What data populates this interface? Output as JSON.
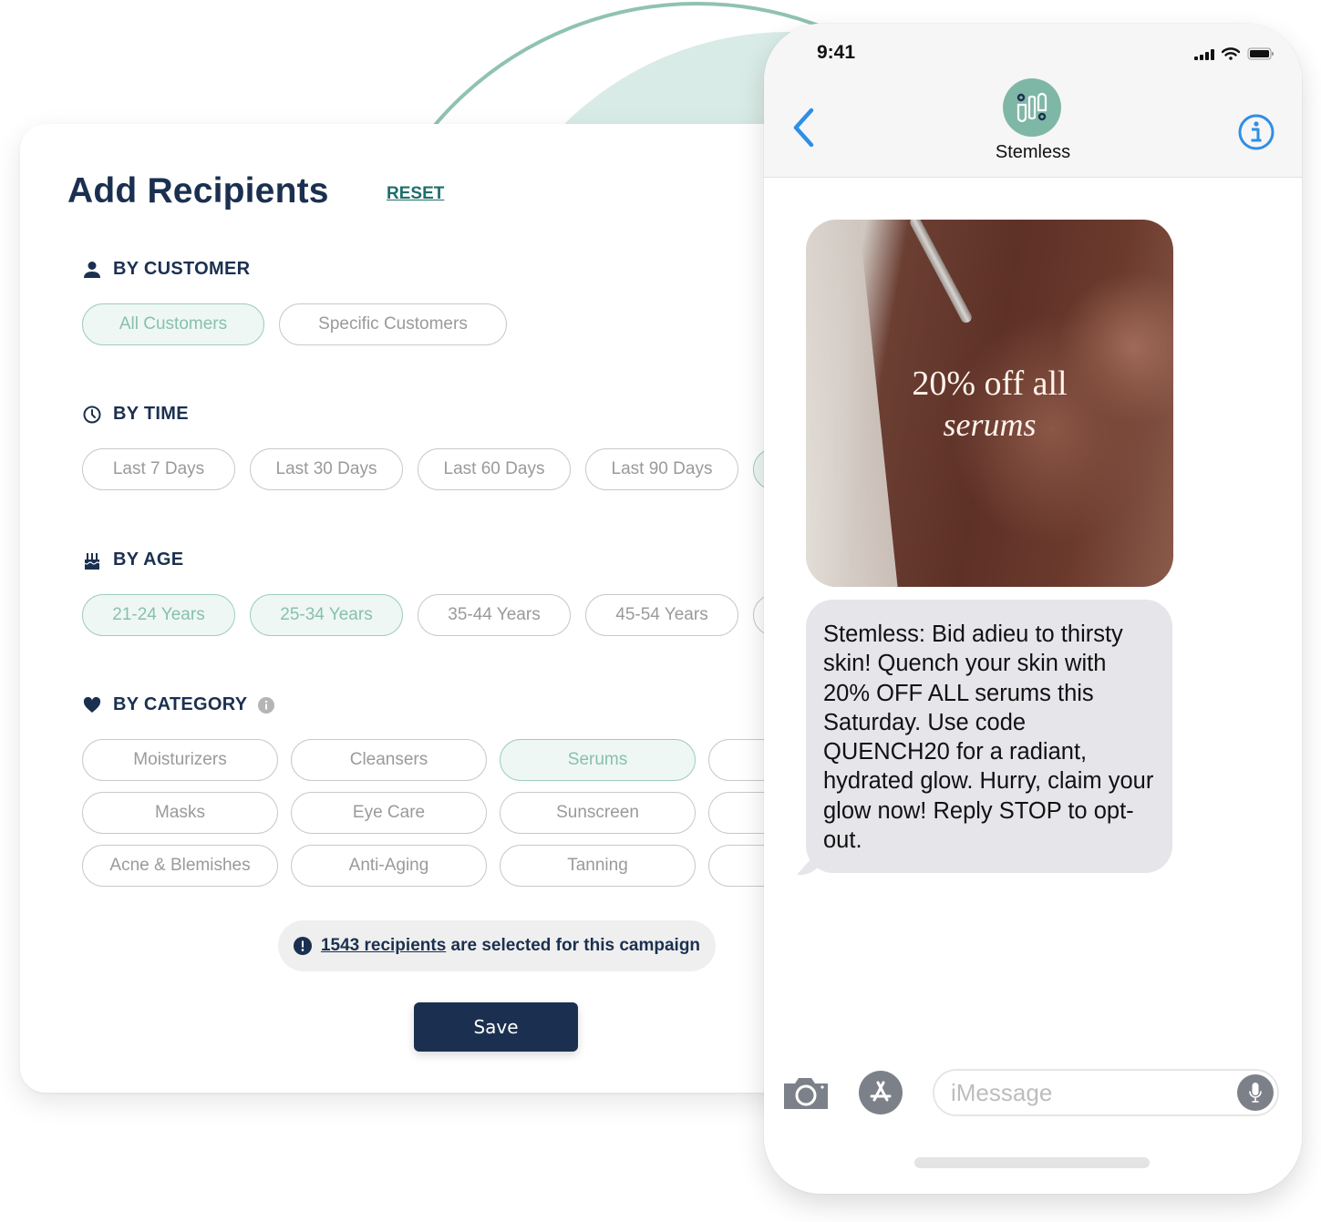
{
  "panel": {
    "title": "Add Recipients",
    "reset_label": "RESET",
    "sections": {
      "customer": {
        "heading": "BY CUSTOMER",
        "icon": "person-icon",
        "options": [
          {
            "label": "All Customers",
            "selected": true
          },
          {
            "label": "Specific Customers",
            "selected": false
          }
        ]
      },
      "time": {
        "heading": "BY TIME",
        "icon": "clock-icon",
        "options": [
          {
            "label": "Last 7 Days",
            "selected": false
          },
          {
            "label": "Last 30 Days",
            "selected": false
          },
          {
            "label": "Last 60 Days",
            "selected": false
          },
          {
            "label": "Last 90 Days",
            "selected": false
          }
        ]
      },
      "age": {
        "heading": "BY AGE",
        "icon": "birthday-cake-icon",
        "options": [
          {
            "label": "21-24 Years",
            "selected": true
          },
          {
            "label": "25-34 Years",
            "selected": true
          },
          {
            "label": "35-44 Years",
            "selected": false
          },
          {
            "label": "45-54 Years",
            "selected": false
          }
        ]
      },
      "category": {
        "heading": "BY CATEGORY",
        "icon": "heart-icon",
        "info_icon": "info-icon",
        "options": [
          {
            "label": "Moisturizers",
            "selected": false
          },
          {
            "label": "Cleansers",
            "selected": false
          },
          {
            "label": "Serums",
            "selected": true
          },
          {
            "label": "Masks",
            "selected": false
          },
          {
            "label": "Eye Care",
            "selected": false
          },
          {
            "label": "Sunscreen",
            "selected": false
          },
          {
            "label": "Acne & Blemishes",
            "selected": false
          },
          {
            "label": "Anti-Aging",
            "selected": false
          },
          {
            "label": "Tanning",
            "selected": false
          }
        ]
      }
    },
    "summary": {
      "count_text": "1543 recipients",
      "rest_text": "are selected for this campaign"
    },
    "save_label": "Save"
  },
  "phone": {
    "time": "9:41",
    "contact_name": "Stemless",
    "promo_image": {
      "line1": "20% off all",
      "line2": "serums"
    },
    "message": "Stemless: Bid adieu to thirsty skin! Quench your skin with 20% OFF ALL serums this Saturday. Use code QUENCH20 for a radiant, hydrated glow. Hurry, claim your glow now! Reply STOP to opt-out.",
    "input_placeholder": "iMessage"
  },
  "colors": {
    "navy": "#1b3050",
    "teal_accent": "#1e6e6a",
    "selected_chip_bg": "#eef7f4",
    "selected_chip_text": "#89bfae",
    "ios_blue": "#2f8fe6",
    "bubble_gray": "#e5e5ea"
  }
}
